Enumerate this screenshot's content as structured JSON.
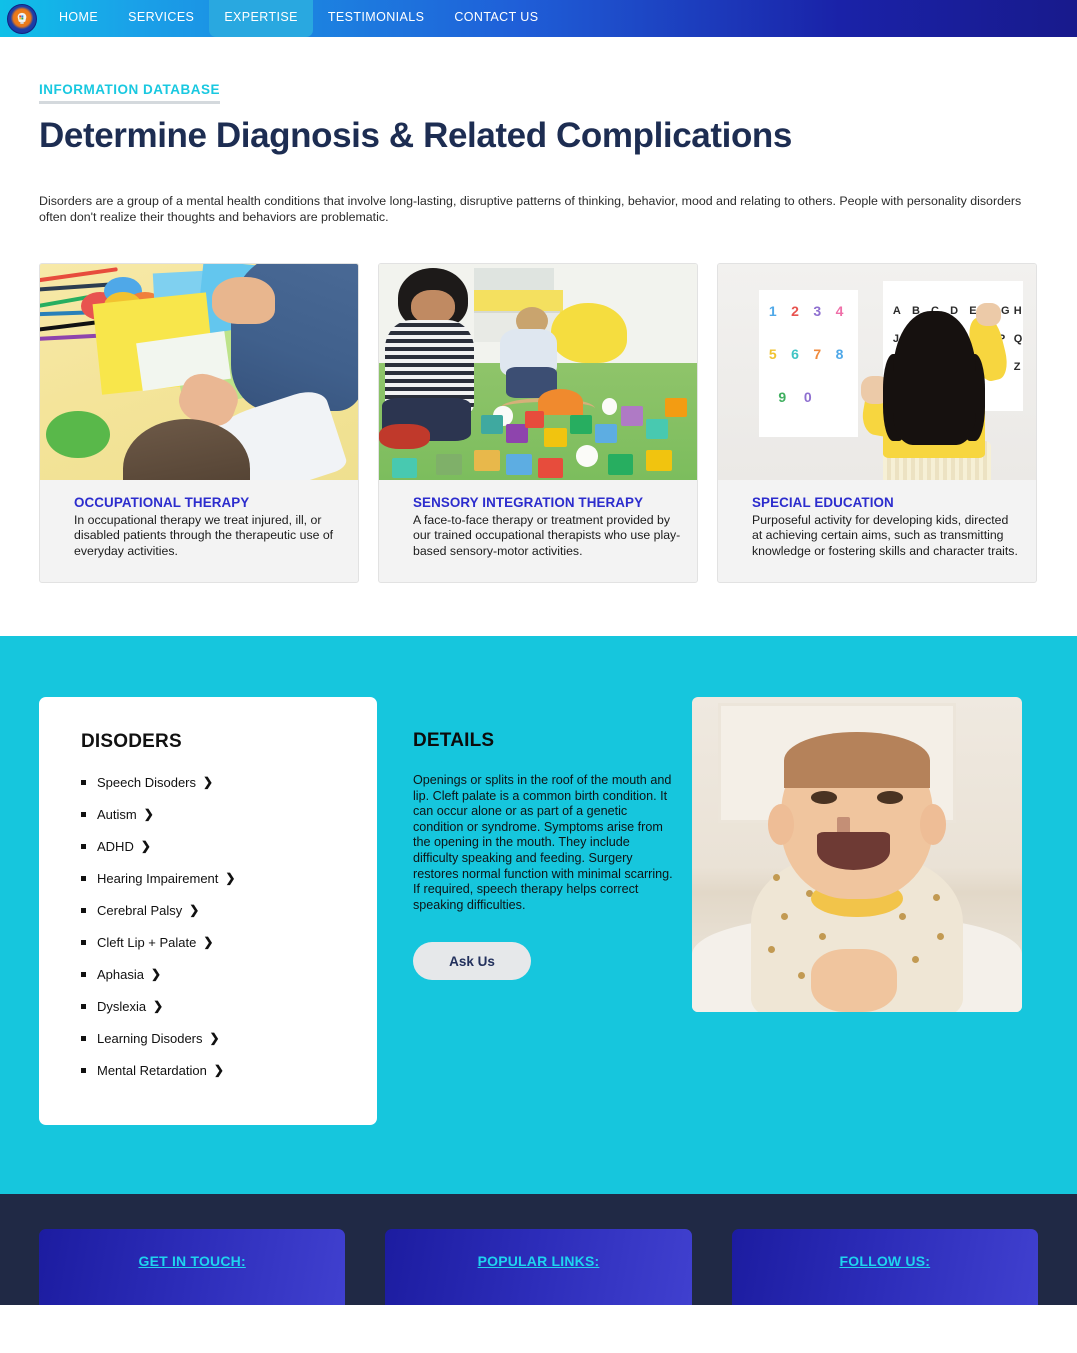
{
  "nav": {
    "logo_name": "clinic-logo",
    "links": [
      {
        "label": "HOME",
        "active": false
      },
      {
        "label": "SERVICES",
        "active": false
      },
      {
        "label": "EXPERTISE",
        "active": true
      },
      {
        "label": "TESTIMONIALS",
        "active": false
      },
      {
        "label": "CONTACT US",
        "active": false
      }
    ],
    "gradient_start": "#0fc0e8",
    "gradient_end": "#181a8c",
    "active_bg": "#29a8e0"
  },
  "header": {
    "eyebrow": "INFORMATION DATABASE",
    "title": "Determine Diagnosis & Related Complications",
    "intro": "Disorders are a group of a mental health conditions that involve long-lasting, disruptive patterns of thinking, behavior, mood and relating to others. People with personality disorders often don't realize their thoughts and behaviors are problematic.",
    "eyebrow_color": "#19c8e0",
    "title_color": "#1d2d52"
  },
  "cards": [
    {
      "title": "OCCUPATIONAL THERAPY",
      "text": "In occupational therapy we treat injured, ill, or disabled patients through the therapeutic use of everyday activities.",
      "image_name": "children-arts-and-crafts-photo"
    },
    {
      "title": "SENSORY INTEGRATION THERAPY",
      "text": "A face-to-face therapy or treatment provided by our trained occupational therapists who use play-based sensory-motor activities.",
      "image_name": "children-playing-with-blocks-photo"
    },
    {
      "title": "SPECIAL EDUCATION",
      "text": "Purposeful activity for developing kids, directed at achieving certain aims, such as transmitting knowledge or fostering skills and character traits.",
      "image_name": "girl-at-alphabet-poster-photo"
    }
  ],
  "disorders": {
    "title": "DISODERS",
    "items": [
      "Speech Disoders",
      "Autism",
      "ADHD",
      "Hearing Impairement",
      "Cerebral Palsy",
      "Cleft Lip + Palate",
      "Aphasia",
      "Dyslexia",
      "Learning Disoders",
      "Mental Retardation"
    ]
  },
  "details": {
    "title": "DETAILS",
    "text": "Openings or splits in the roof of the mouth and lip. Cleft palate is a common birth condition. It can occur alone or as part of a genetic condition or syndrome. Symptoms arise from the opening in the mouth. They include difficulty speaking and feeding. Surgery restores normal function with minimal scarring. If required, speech therapy helps correct speaking difficulties.",
    "button_label": "Ask Us",
    "image_name": "smiling-baby-photo"
  },
  "section_colors": {
    "cyan_band": "#16c6dd",
    "footer_bg": "#202945",
    "footer_card_start": "#1c1ca0",
    "footer_card_end": "#4040cf",
    "footer_link": "#1fd4ef"
  },
  "footer": {
    "columns": [
      {
        "heading": "GET IN TOUCH:"
      },
      {
        "heading": "POPULAR LINKS:"
      },
      {
        "heading": "FOLLOW US:"
      }
    ]
  }
}
